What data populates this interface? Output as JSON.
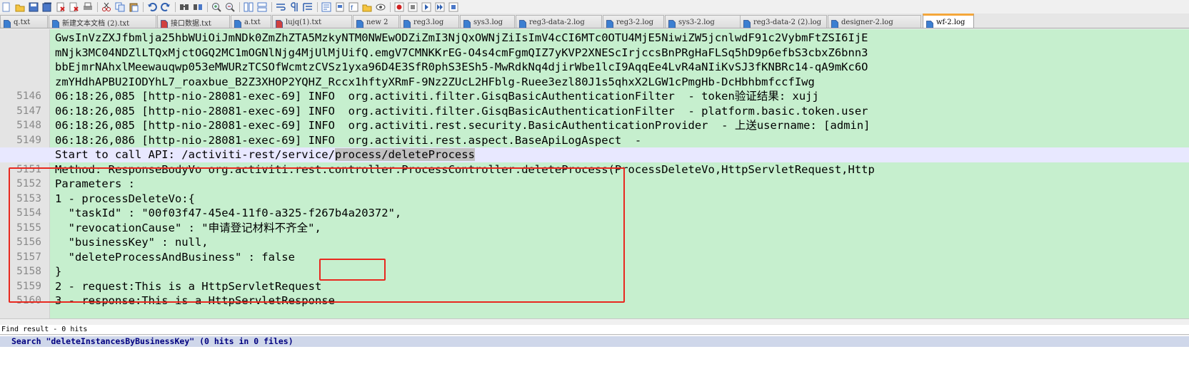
{
  "toolbar": {
    "icons": [
      "new-file-icon",
      "open-file-icon",
      "save-icon",
      "save-all-icon",
      "close-icon",
      "close-all-icon",
      "print-icon",
      "cut-icon",
      "copy-icon",
      "paste-icon",
      "undo-icon",
      "redo-icon",
      "find-icon",
      "replace-icon",
      "zoom-in-icon",
      "zoom-out-icon",
      "sync-vertical-icon",
      "sync-horizontal-icon",
      "word-wrap-icon",
      "show-all-chars-icon",
      "indent-guide-icon",
      "user-language-icon",
      "doc-map-icon",
      "function-list-icon",
      "folder-workspace-icon",
      "monitoring-icon",
      "record-macro-icon",
      "stop-record-icon",
      "play-macro-icon",
      "run-macro-multiple-icon",
      "save-macro-icon"
    ]
  },
  "tabs": [
    {
      "label": "q.txt",
      "icon": "#3c7fd1",
      "active": false
    },
    {
      "label": "新建文本文档 (2).txt",
      "icon": "#3c7fd1",
      "active": false
    },
    {
      "label": "接口数据.txt",
      "icon": "#d04040",
      "active": false
    },
    {
      "label": "a.txt",
      "icon": "#3c7fd1",
      "active": false
    },
    {
      "label": "lujq(1).txt",
      "icon": "#d04040",
      "active": false
    },
    {
      "label": "new 2",
      "icon": "#3c7fd1",
      "active": false
    },
    {
      "label": "reg3.log",
      "icon": "#3c7fd1",
      "active": false
    },
    {
      "label": "sys3.log",
      "icon": "#3c7fd1",
      "active": false
    },
    {
      "label": "reg3-data-2.log",
      "icon": "#3c7fd1",
      "active": false
    },
    {
      "label": "reg3-2.log",
      "icon": "#3c7fd1",
      "active": false
    },
    {
      "label": "sys3-2.log",
      "icon": "#3c7fd1",
      "active": false
    },
    {
      "label": "reg3-data-2 (2).log",
      "icon": "#3c7fd1",
      "active": false
    },
    {
      "label": "designer-2.log",
      "icon": "#3c7fd1",
      "active": false
    },
    {
      "label": "wf-2.log",
      "icon": "#3c7fd1",
      "active": true
    }
  ],
  "editor": {
    "lines": [
      {
        "num": "",
        "text": "GwsInVzZXJfbmlja25hbWUiOiJmNDk0ZmZhZTA5MzkyNTM0NWEwODZiZmI3NjQxOWNjZiIsImV4cCI6MTc0OTU4MjE5NiwiZW5jcnlwdF91c2VybmFtZSI6IjE"
      },
      {
        "num": "",
        "text": "mNjk3MC04NDZlLTQxMjctOGQ2MC1mOGNlNjg4MjUlMjUifQ.emgV7CMNKKrEG-O4s4cmFgmQIZ7yKVP2XNEScIrjccsBnPRgHaFLSq5hD9p6efbS3cbxZ6bnn3"
      },
      {
        "num": "",
        "text": "bbEjmrNAhxlMeewauqwp053eMWURzTCSOfWcmtzCVSz1yxa96D4E3SfR0phS3ESh5-MwRdkNq4djirWbe1lcI9AqqEe4LvR4aNIiKvSJ3fKNBRc14-qA9mKc6O"
      },
      {
        "num": "",
        "text": "zmYHdhAPBU2IODYhL7_roaxbue_B2Z3XHOP2YQHZ_Rccx1hftyXRmF-9Nz2ZUcL2HFblg-Ruee3ezl80J1s5qhxX2LGW1cPmgHb-DcHbhbmfccfIwg"
      },
      {
        "num": "5146",
        "text": "06:18:26,085 [http-nio-28081-exec-69] INFO  org.activiti.filter.GisqBasicAuthenticationFilter  - token验证结果: xujj"
      },
      {
        "num": "5147",
        "text": "06:18:26,085 [http-nio-28081-exec-69] INFO  org.activiti.filter.GisqBasicAuthenticationFilter  - platform.basic.token.user"
      },
      {
        "num": "5148",
        "text": "06:18:26,085 [http-nio-28081-exec-69] INFO  org.activiti.rest.security.BasicAuthenticationProvider  - 上送username: [admin]"
      },
      {
        "num": "5149",
        "text": "06:18:26,086 [http-nio-28081-exec-69] INFO  org.activiti.rest.aspect.BaseApiLogAspect  -"
      },
      {
        "num": "",
        "text": "Start to call API: /activiti-rest/service/process/deleteProcess",
        "sel_prefix": "Start to call API: /activiti-rest/service/",
        "sel": "process/deleteProcess"
      },
      {
        "num": "5151",
        "text": "Method: ResponseBodyVo org.activiti.rest.controller.ProcessController.deleteProcess(ProcessDeleteVo,HttpServletRequest,Http"
      },
      {
        "num": "5152",
        "text": "Parameters :"
      },
      {
        "num": "5153",
        "text": "1 - processDeleteVo:{"
      },
      {
        "num": "5154",
        "text": "  \"taskId\" : \"00f03f47-45e4-11f0-a325-f267b4a20372\","
      },
      {
        "num": "5155",
        "text": "  \"revocationCause\" : \"申请登记材料不齐全\","
      },
      {
        "num": "5156",
        "text": "  \"businessKey\" : null,"
      },
      {
        "num": "5157",
        "text": "  \"deleteProcessAndBusiness\" : false"
      },
      {
        "num": "5158",
        "text": "}"
      },
      {
        "num": "5159",
        "text": "2 - request:This is a HttpServletRequest"
      },
      {
        "num": "5160",
        "text": "3 - response:This is a HttpServletResponse"
      }
    ]
  },
  "find_panel": {
    "title": "Find result - 0 hits",
    "search_line": "Search \"deleteInstancesByBusinessKey\" (0 hits in 0 files)"
  },
  "colors": {
    "editor_bg": "#c6efce",
    "gutter_bg": "#e4e4e4",
    "annotation_red": "#e8281f",
    "tab_active_accent": "#f4a73a",
    "find_text": "#000080"
  }
}
